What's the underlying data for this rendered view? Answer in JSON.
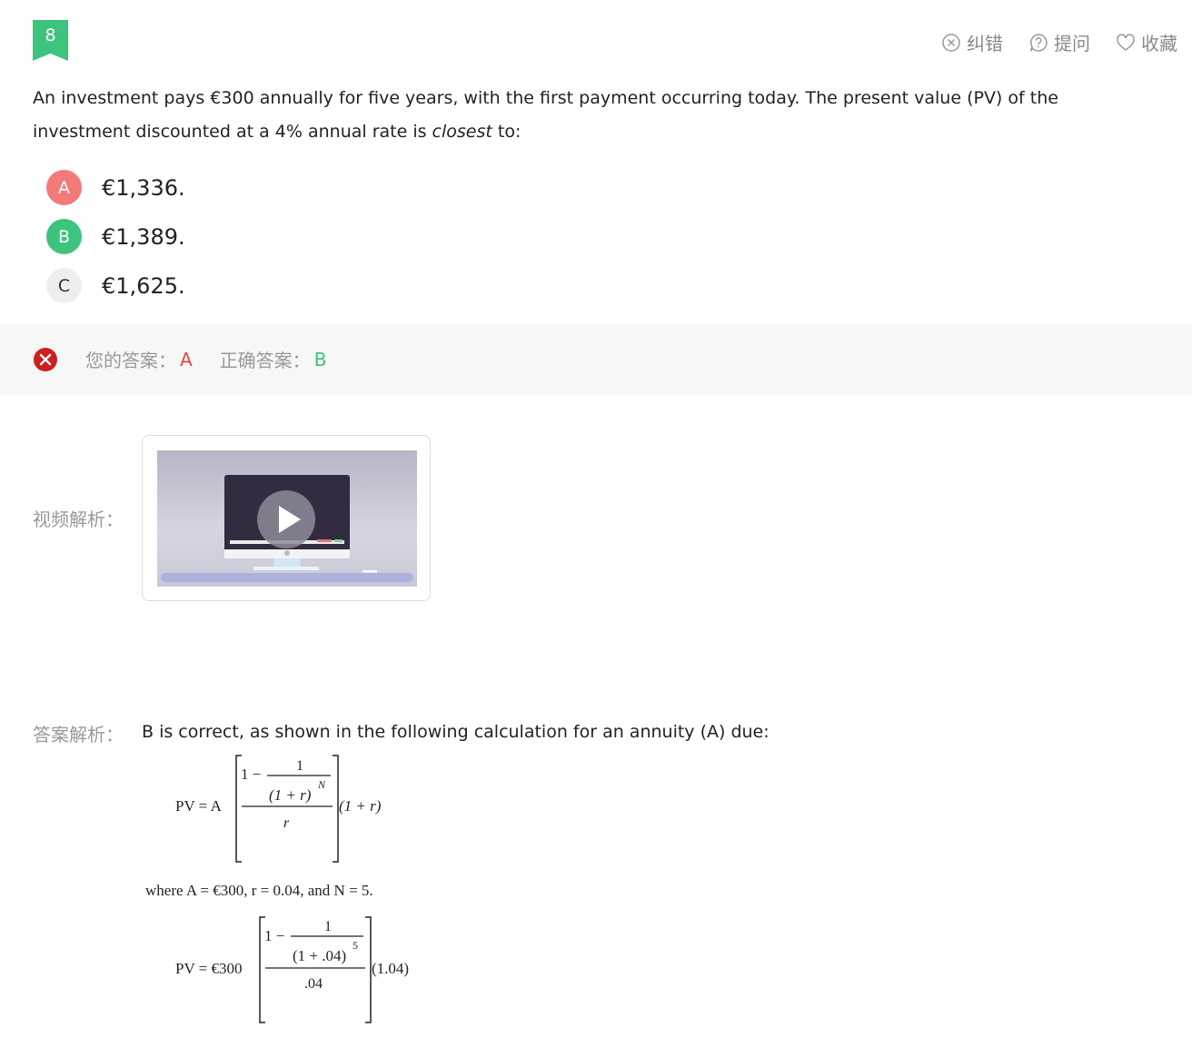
{
  "question": {
    "number": "8",
    "text_before": "An investment pays €300 annually for five years, with the first payment occurring today. The present value (PV) of the investment discounted at a 4% annual  rate is ",
    "text_emphasis": "closest",
    "text_after": " to:"
  },
  "toolbar": {
    "report_label": "纠错",
    "ask_label": "提问",
    "favorite_label": "收藏"
  },
  "options": [
    {
      "letter": "A",
      "text": "€1,336.",
      "state": "wrong"
    },
    {
      "letter": "B",
      "text": "€1,389.",
      "state": "correct"
    },
    {
      "letter": "C",
      "text": "€1,625.",
      "state": "neutral"
    }
  ],
  "answer": {
    "your_label": "您的答案：",
    "your_value": "A",
    "correct_label": "正确答案：",
    "correct_value": "B"
  },
  "video": {
    "label": "视频解析："
  },
  "analysis": {
    "label": "答案解析：",
    "text": "B is correct, as shown in the following calculation for an annuity (A) due:",
    "formula_general": {
      "lhs": "PV = A",
      "numerator_one": "1 −",
      "inner_numerator": "1",
      "inner_denominator": "(1 + r)",
      "exponent": "N",
      "denominator": "r",
      "multiplier": "(1 + r)"
    },
    "where_text": "where A = €300, r = 0.04, and N = 5.",
    "formula_specific": {
      "lhs": "PV = €300",
      "numerator_one": "1 −",
      "inner_numerator": "1",
      "inner_denominator": "(1 + .04)",
      "exponent": "5",
      "denominator": ".04",
      "multiplier": "(1.04)"
    }
  },
  "colors": {
    "green": "#3cc47c",
    "red": "#e64545",
    "wrong_option": "#f47a7a",
    "muted": "#999999"
  }
}
